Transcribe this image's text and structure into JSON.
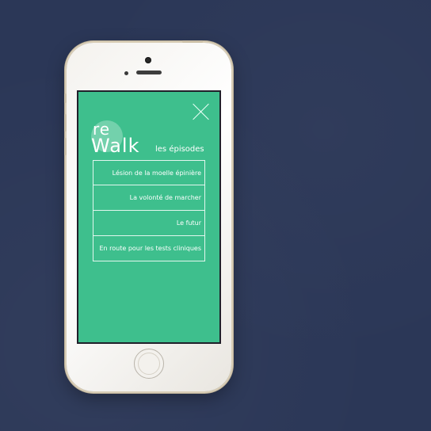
{
  "app": {
    "logo_top": "re",
    "logo_bottom": "Walk",
    "section_title": "les épisodes"
  },
  "episodes": [
    {
      "label": "Lésion de la moelle épinière"
    },
    {
      "label": "La volonté de marcher"
    },
    {
      "label": "Le futur"
    },
    {
      "label": "En route pour les tests cliniques"
    }
  ],
  "icons": {
    "close": "close-icon"
  },
  "colors": {
    "background": "#2b3757",
    "screen_accent": "#3ebf8d",
    "text": "#ffffff",
    "phone_body": "#f4f2ee"
  }
}
